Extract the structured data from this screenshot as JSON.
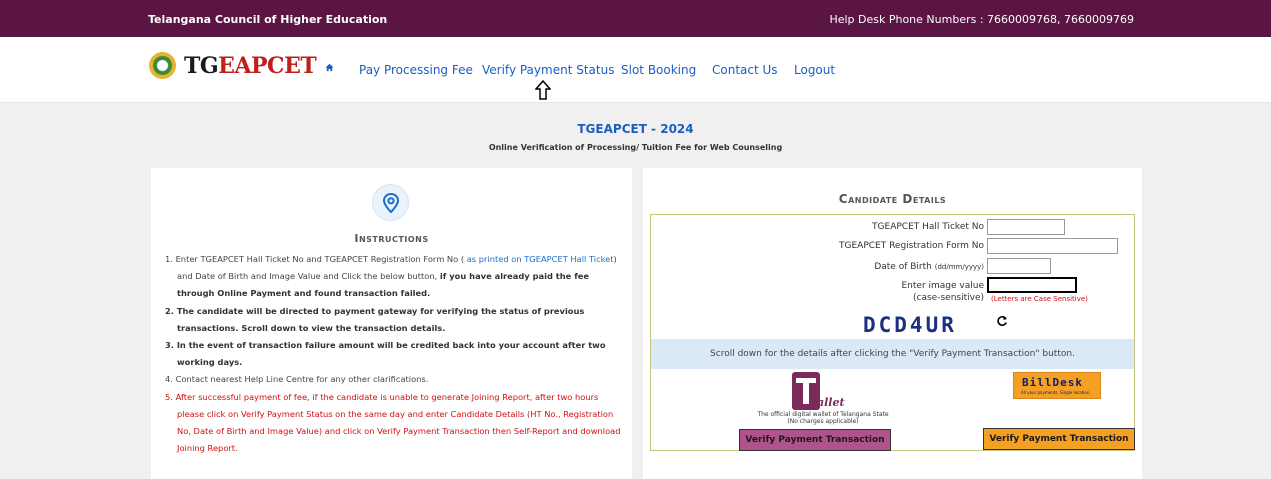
{
  "topbar": {
    "org": "Telangana Council of Higher Education",
    "helpdesk": "Help Desk Phone Numbers : 7660009768, 7660009769"
  },
  "brand": {
    "prefix": "TG",
    "suffix": "EAPCET"
  },
  "nav": {
    "home_icon": "home-icon",
    "items": [
      "Pay Processing Fee",
      "Verify Payment Status",
      "Slot Booking",
      "Contact Us",
      "Logout"
    ]
  },
  "page": {
    "title": "TGEAPCET - 2024",
    "subtitle": "Online Verification of Processing/ Tuition Fee for Web Counseling"
  },
  "instructions": {
    "icon": "location-pin-icon",
    "title": "Instructions",
    "items": [
      {
        "n": "1.",
        "a": "Enter TGEAPCET Hall Ticket No and TGEAPCET Registration Form No ( ",
        "b": "as printed on TGEAPCET Hall Ticket",
        "c": ") and Date of Birth and Image Value and Click the below button, ",
        "d": "if you have already paid the fee through Online Payment and found transaction failed."
      },
      {
        "n": "2.",
        "text": "The candidate will be directed to payment gateway for verifying the status of previous transactions. Scroll down to view the transaction details."
      },
      {
        "n": "3.",
        "text": "In the event of transaction failure amount will be credited back into your account after two working days."
      },
      {
        "n": "4.",
        "text": "Contact nearest Help Line Centre for any other clarifications."
      },
      {
        "n": "5.",
        "text": "After successful payment of fee, if the candidate is unable to generate Joining Report, after two hours please click on Verify Payment Status on the same day and enter Candidate Details (HT No., Registration No, Date of Birth and Image Value) and click on Verify Payment Transaction then Self-Report and download Joining Report."
      }
    ]
  },
  "candidate": {
    "title": "Candidate Details",
    "hall_ticket_label": "TGEAPCET Hall Ticket No",
    "reg_form_label": "TGEAPCET Registration Form No",
    "dob_label": "Date of Birth",
    "dob_format": "(dd/mm/yyyy)",
    "image_label": "Enter image value",
    "case_label": "(case-sensitive)",
    "case_note": "(Letters are Case Sensitive)",
    "captcha": "DCD4UR",
    "refresh_icon": "refresh-icon",
    "scroll_note": "Scroll down for the details after clicking the \"Verify Payment Transaction\" button.",
    "twallet_caption": "The official digital wallet of Telangana State",
    "twallet_sub": "(No charges applicable)",
    "twallet_button": "Verify Payment Transaction",
    "billdesk_logo": "BillDesk",
    "billdesk_tag": "All your payments. Single location.",
    "billdesk_button": "Verify Payment Transaction"
  }
}
